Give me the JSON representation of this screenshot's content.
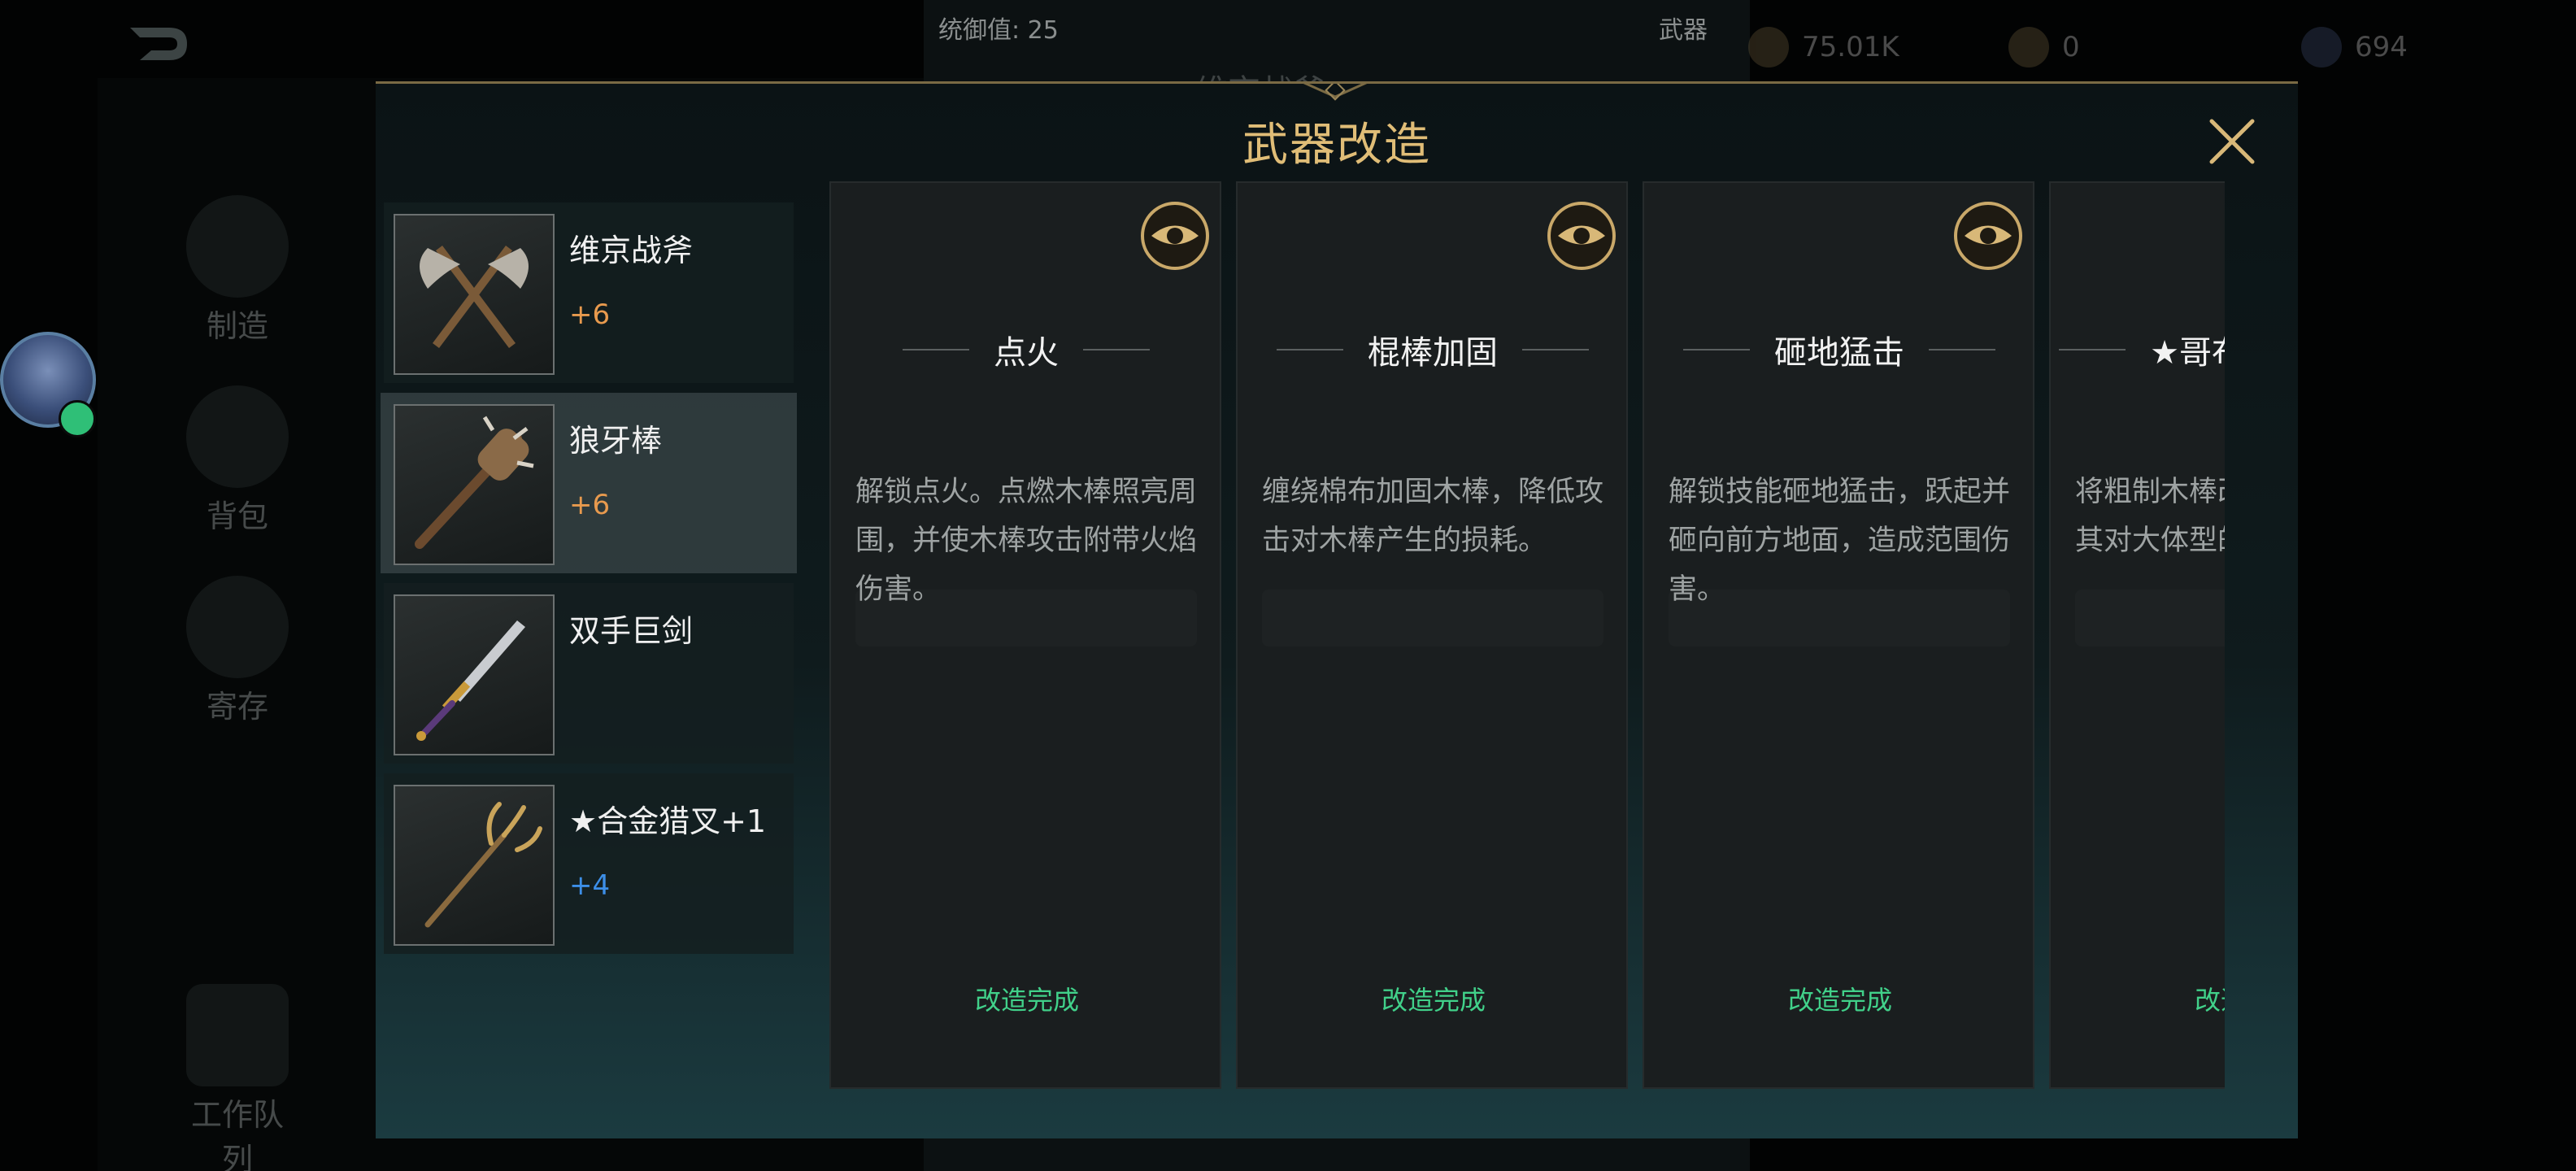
{
  "hud": {
    "command_value": "统御值: 25",
    "tab_label": "武器",
    "behind_title": "维京战斧",
    "resources": [
      "75.01K",
      "0",
      "694"
    ],
    "sidebar": [
      "制造",
      "背包",
      "寄存",
      "工作队列"
    ]
  },
  "modal": {
    "title": "武器改造",
    "accent_color": "#e0bd77"
  },
  "weapons": [
    {
      "name": "维京战斧",
      "level": "+6",
      "level_color": "#e89a4e",
      "icon": "battle-axe-icon"
    },
    {
      "name": "狼牙棒",
      "level": "+6",
      "level_color": "#e89a4e",
      "icon": "spiked-club-icon",
      "selected": true
    },
    {
      "name": "双手巨剑",
      "level": "",
      "level_color": "#e89a4e",
      "icon": "greatsword-icon"
    },
    {
      "name": "★合金猎叉+1",
      "level": "+4",
      "level_color": "#3d8fe8",
      "icon": "trident-icon"
    }
  ],
  "mods": [
    {
      "title": "点火",
      "description": "解锁点火。点燃木棒照亮周围，并使木棒攻击附带火焰伤害。",
      "status": "改造完成"
    },
    {
      "title": "棍棒加固",
      "description": "缠绕棉布加固木棒，降低攻击对木棒产生的损耗。",
      "status": "改造完成"
    },
    {
      "title": "砸地猛击",
      "description": "解锁技能砸地猛击，跃起并砸向前方地面，造成范围伤害。",
      "status": "改造完成"
    },
    {
      "title": "★哥布林碎骨",
      "description": "将粗制木棒改造为骨棒，使其对大体型的目标",
      "status": "改造完成"
    }
  ]
}
